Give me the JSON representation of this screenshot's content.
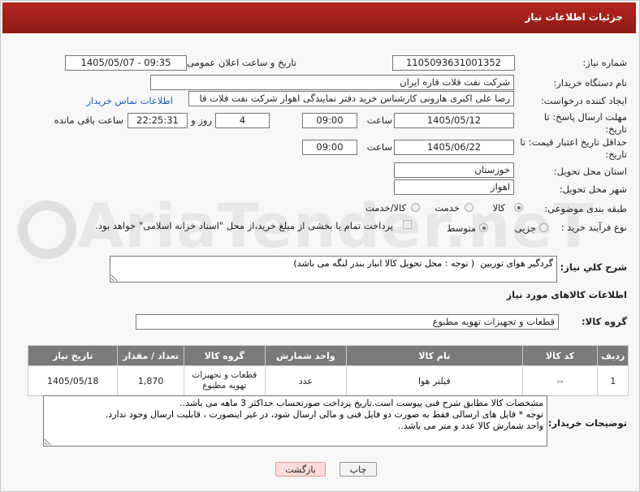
{
  "window_title": "جزئیات اطلاعات نیاز",
  "fields": {
    "need_number_label": "شماره نیاز:",
    "need_number": "1105093631001352",
    "announce_label": "تاریخ و ساعت اعلان عمومی:",
    "announce_value": "1405/05/07 - 09:35",
    "buyer_org_label": "نام دستگاه خریدار:",
    "buyer_org": "شرکت نفت فلات قاره ایران",
    "creator_label": "ایجاد کننده درخواست:",
    "creator": "رضا علی اکبری هارونی کارشناس خرید دفتر نمایندگی اهواز شرکت نفت فلات قا",
    "contact_link": "اطلاعات تماس خریدار",
    "reply_deadline_label": "مهلت ارسال پاسخ: تا تاریخ:",
    "reply_date": "1405/05/12",
    "time_label": "ساعت",
    "reply_time": "09:00",
    "days_value": "4",
    "days_label": "روز و",
    "remaining_time": "22:25:31",
    "remaining_label": "ساعت باقی مانده",
    "price_validity_label": "حداقل تاریخ اعتبار قیمت: تا تاریخ:",
    "price_date": "1405/06/22",
    "price_time": "09:00",
    "province_label": "استان محل تحویل:",
    "province": "خوزستان",
    "city_label": "شهر محل تحویل:",
    "city": "اهواز",
    "category_label": "طبقه بندی موضوعی:",
    "category_options": [
      "کالا",
      "خدمت",
      "کالا/خدمت"
    ],
    "process_label": "نوع فرآیند خرید :",
    "process_options": [
      "جزیی",
      "متوسط"
    ],
    "payment_note": "پرداخت تمام یا بخشی از مبلغ خرید،از محل \"اسناد خزانه اسلامی\" خواهد بود.",
    "summary_label": "شرح کلي نياز:",
    "summary": "گردگیر هوای توربین  ( توجه : محل تحویل کالا انبار بندر لنگه می باشد)",
    "goods_info_title": "اطلاعات کالاهای مورد نیاز",
    "goods_group_label": "گروه کالا:",
    "goods_group": "قطعات و تجهیزات تهویه مطبوع",
    "buyer_notes_label": "توضیحات خریدار:",
    "buyer_notes": "مشخصات کالا مطابق شرح فنی پیوست است.تاریخ پرداخت صورتحساب حداکثر 3 ماهه می باشد..\nتوجه * فایل های ارسالی فقط به صورت دو فایل فنی و مالی ارسال شود، در غیر اینصورت ، قابلیت ارسال وجود ندارد.\nواحد شمارش کالا عدد و متر می باشد.."
  },
  "table": {
    "headers": [
      "ردیف",
      "کد کالا",
      "نام کالا",
      "واحد شمارش",
      "گروه کالا",
      "تعداد / مقدار",
      "تاریخ نیاز"
    ],
    "rows": [
      [
        "1",
        "--",
        "فیلتر هوا",
        "عدد",
        "قطعات و تجهیزات تهویه مطبوع",
        "1,870",
        "1405/05/18"
      ]
    ]
  },
  "buttons": {
    "print": "چاپ",
    "back": "بازگشت"
  },
  "watermark": "AriaTender.neT",
  "colors": {
    "title_bar": "#a3221b",
    "table_header": "#7a7a7a",
    "link": "#1a5fb4"
  }
}
